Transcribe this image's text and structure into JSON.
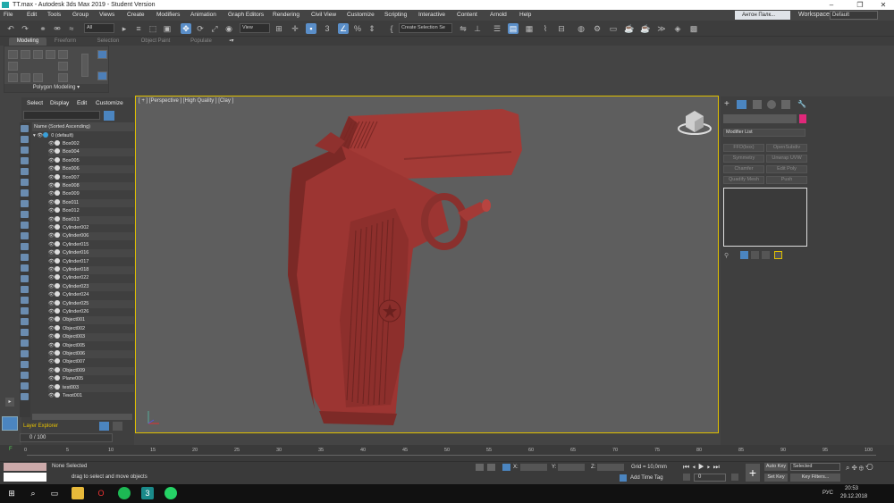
{
  "window": {
    "title": "TT.max - Autodesk 3ds Max 2019 - Student Version",
    "minimize": "–",
    "maximize": "❐",
    "close": "✕"
  },
  "menu": [
    "File",
    "Edit",
    "Tools",
    "Group",
    "Views",
    "Create",
    "Modifiers",
    "Animation",
    "Graph Editors",
    "Rendering",
    "Civil View",
    "Customize",
    "Scripting",
    "Interactive",
    "Content",
    "Arnold",
    "Help"
  ],
  "user": {
    "name": "Антон Палк...",
    "workspaces_label": "Workspaces:",
    "workspace": "Default"
  },
  "toolbar": {
    "filter": "All",
    "view": "View",
    "percent": "3",
    "selection_set": "Create Selection Se"
  },
  "ribbon_tabs": [
    "Modeling",
    "Freeform",
    "Selection",
    "Object Paint",
    "Populate"
  ],
  "ribbon": {
    "panel_label": "Polygon Modeling ▾"
  },
  "scene_explorer": {
    "tabs": [
      "Select",
      "Display",
      "Edit",
      "Customize"
    ],
    "column_header": "Name (Sorted Ascending)",
    "root": "0 (default)",
    "items": [
      "Box002",
      "Box004",
      "Box005",
      "Box006",
      "Box007",
      "Box008",
      "Box009",
      "Box011",
      "Box012",
      "Box013",
      "Cylinder002",
      "Cylinder006",
      "Cylinder015",
      "Cylinder016",
      "Cylinder017",
      "Cylinder018",
      "Cylinder022",
      "Cylinder023",
      "Cylinder024",
      "Cylinder025",
      "Cylinder026",
      "Object001",
      "Object002",
      "Object003",
      "Object005",
      "Object006",
      "Object007",
      "Object009",
      "Plane005",
      "test003",
      "Текst001"
    ],
    "footer_label": "Layer Explorer"
  },
  "viewport": {
    "label": "[ + ] [Perspective ] [High Quality ] [Clay ]",
    "model_color": "#a33a36"
  },
  "command_panel": {
    "modifier_list": "Modifier List",
    "buttons": [
      "FFD(box)",
      "OpenSubdiv",
      "Symmetry",
      "Unwrap UVW",
      "Chamfer",
      "Edit Poly",
      "Quadify Mesh",
      "Push"
    ],
    "color_swatch": "#e0287a"
  },
  "timeline": {
    "frame": "0 / 100",
    "ticks": [
      "0",
      "5",
      "10",
      "15",
      "20",
      "25",
      "30",
      "35",
      "40",
      "45",
      "50",
      "55",
      "60",
      "65",
      "70",
      "75",
      "80",
      "85",
      "90",
      "95",
      "100"
    ]
  },
  "status": {
    "none_selected": "None Selected",
    "prompt": "drag to select and move objects",
    "x_label": "X:",
    "y_label": "Y:",
    "z_label": "Z:",
    "grid": "Grid = 10,0mm",
    "add_time_tag": "Add Time Tag",
    "auto_key": "Auto Key",
    "selected": "Selected",
    "set_key": "Set Key",
    "key_filters": "Key Filters...",
    "frame_value": "0"
  },
  "taskbar": {
    "lang": "РУС",
    "time": "20:53",
    "date": "29.12.2018"
  }
}
